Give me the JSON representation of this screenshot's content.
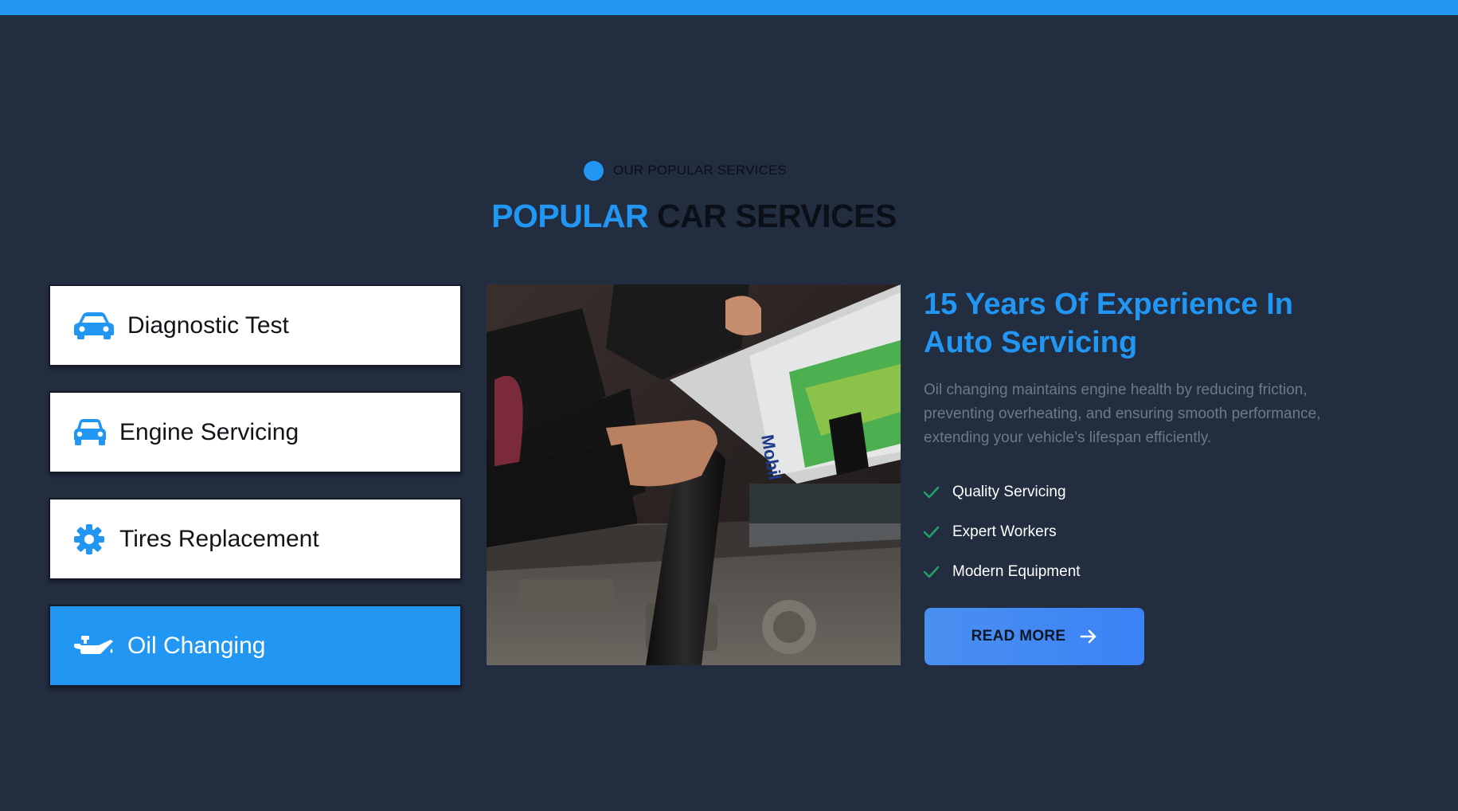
{
  "eyebrow": {
    "label": "OUR POPULAR SERVICES"
  },
  "heading": {
    "highlight": "POPULAR",
    "rest": "CAR SERVICES"
  },
  "services": [
    {
      "label": "Diagnostic Test",
      "icon": "car-icon",
      "active": false
    },
    {
      "label": "Engine Servicing",
      "icon": "car-front-icon",
      "active": false
    },
    {
      "label": "Tires Replacement",
      "icon": "gear-icon",
      "active": false
    },
    {
      "label": "Oil Changing",
      "icon": "oil-can-icon",
      "active": true
    }
  ],
  "image": {
    "subject": "mechanic pouring motor oil into engine",
    "label_text": "Mobil 1"
  },
  "detail": {
    "title": "15 Years Of Experience In Auto Servicing",
    "description": "Oil changing maintains engine health by reducing friction, preventing overheating, and ensuring smooth performance, extending your vehicle’s lifespan efficiently.",
    "features": [
      "Quality Servicing",
      "Expert Workers",
      "Modern Equipment"
    ],
    "cta_label": "READ MORE"
  },
  "colors": {
    "accent": "#2196f3",
    "background": "#232d40",
    "check": "#22a06b"
  }
}
